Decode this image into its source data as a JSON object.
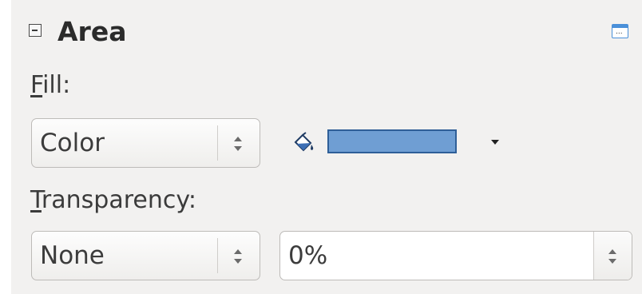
{
  "panel": {
    "title": "Area",
    "collapse_icon": "minus-box-icon",
    "more_options_icon": "more-options-icon",
    "more_options_glyph": "..."
  },
  "fill": {
    "label_accel": "F",
    "label_rest": "ill:",
    "type_value": "Color",
    "bucket_icon": "paint-bucket-icon",
    "color_swatch": "#6f9ed3",
    "dropdown_icon": "dropdown-arrow-icon"
  },
  "transparency": {
    "label_accel": "T",
    "label_rest": "ransparency:",
    "type_value": "None",
    "percent_value": "0%"
  },
  "colors": {
    "panel_bg": "#f2f1f0",
    "swatch_border": "#2f5f98",
    "accent": "#4a90d9"
  }
}
